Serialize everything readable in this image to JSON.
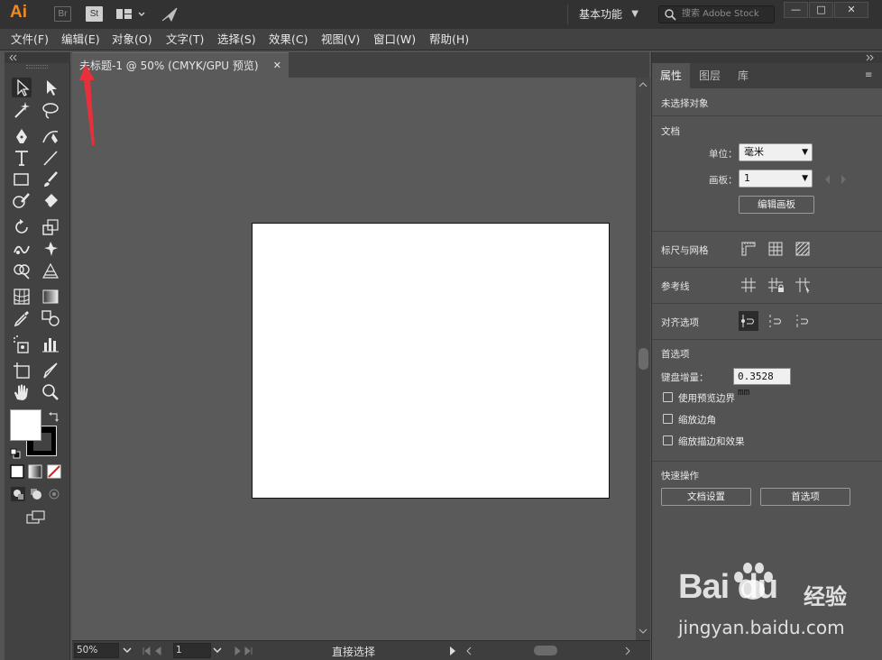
{
  "app": {
    "logo": "Ai",
    "bridge": "Br",
    "stock": "St",
    "workspace": "基本功能",
    "stock_search_placeholder": "搜索 Adobe Stock"
  },
  "window_controls": {
    "minimize": "—",
    "maximize": "□",
    "close": "✕"
  },
  "menu": [
    "文件(F)",
    "编辑(E)",
    "对象(O)",
    "文字(T)",
    "选择(S)",
    "效果(C)",
    "视图(V)",
    "窗口(W)",
    "帮助(H)"
  ],
  "document": {
    "tab_title": "未标题-1 @ 50% (CMYK/GPU 预览)",
    "close": "✕",
    "zoom": "50%",
    "artboard_number": "1",
    "status": "直接选择"
  },
  "right_panel": {
    "tabs": [
      "属性",
      "图层",
      "库"
    ],
    "no_selection": "未选择对象",
    "document_section": "文档",
    "unit_label": "单位：",
    "unit_value": "毫米",
    "artboard_label": "画板：",
    "artboard_value": "1",
    "edit_artboards_button": "编辑画板",
    "rulers_grids": "标尺与网格",
    "guides": "参考线",
    "align_options": "对齐选项",
    "preferences": "首选项",
    "keyboard_increment_label": "键盘增量：",
    "keyboard_increment_value": "0.3528 mm",
    "checkboxes": [
      "使用预览边界",
      "缩放边角",
      "缩放描边和效果"
    ],
    "quick_actions": "快速操作",
    "doc_setup_button": "文档设置",
    "prefs_button": "首选项"
  },
  "watermark": {
    "brand": "Bai du",
    "cn": "经验",
    "url": "jingyan.baidu.com"
  },
  "colors": {
    "accent": "#f08a24",
    "annotation": "#e8303a"
  }
}
